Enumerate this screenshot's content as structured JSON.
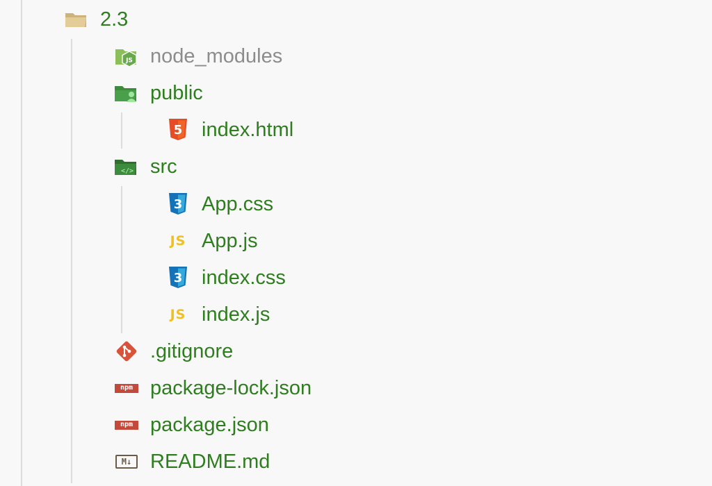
{
  "explorer": {
    "root": {
      "label": "2.3",
      "icon": "folder-open-icon"
    },
    "items": [
      {
        "label": "node_modules",
        "icon": "nodejs-folder-icon",
        "muted": true
      },
      {
        "label": "public",
        "icon": "public-folder-icon"
      },
      {
        "label": "index.html",
        "icon": "html5-icon"
      },
      {
        "label": "src",
        "icon": "src-folder-icon"
      },
      {
        "label": "App.css",
        "icon": "css3-icon"
      },
      {
        "label": "App.js",
        "icon": "javascript-icon",
        "glyph": "JS"
      },
      {
        "label": "index.css",
        "icon": "css3-icon"
      },
      {
        "label": "index.js",
        "icon": "javascript-icon",
        "glyph": "JS"
      },
      {
        "label": ".gitignore",
        "icon": "git-icon"
      },
      {
        "label": "package-lock.json",
        "icon": "npm-icon",
        "glyph": "npm"
      },
      {
        "label": "package.json",
        "icon": "npm-icon",
        "glyph": "npm"
      },
      {
        "label": "README.md",
        "icon": "markdown-icon",
        "glyph": "M↓"
      }
    ]
  },
  "colors": {
    "background": "#f8f8f8",
    "label": "#2e7d1f",
    "muted_label": "#8c8c8c",
    "guide": "#dcdcdc",
    "html": "#e44d26",
    "css": "#1572b6",
    "js": "#f0c020",
    "git": "#d9533a",
    "npm": "#c34a3a",
    "folder": "#dcc38c",
    "green_folder": "#3d8b3d"
  }
}
